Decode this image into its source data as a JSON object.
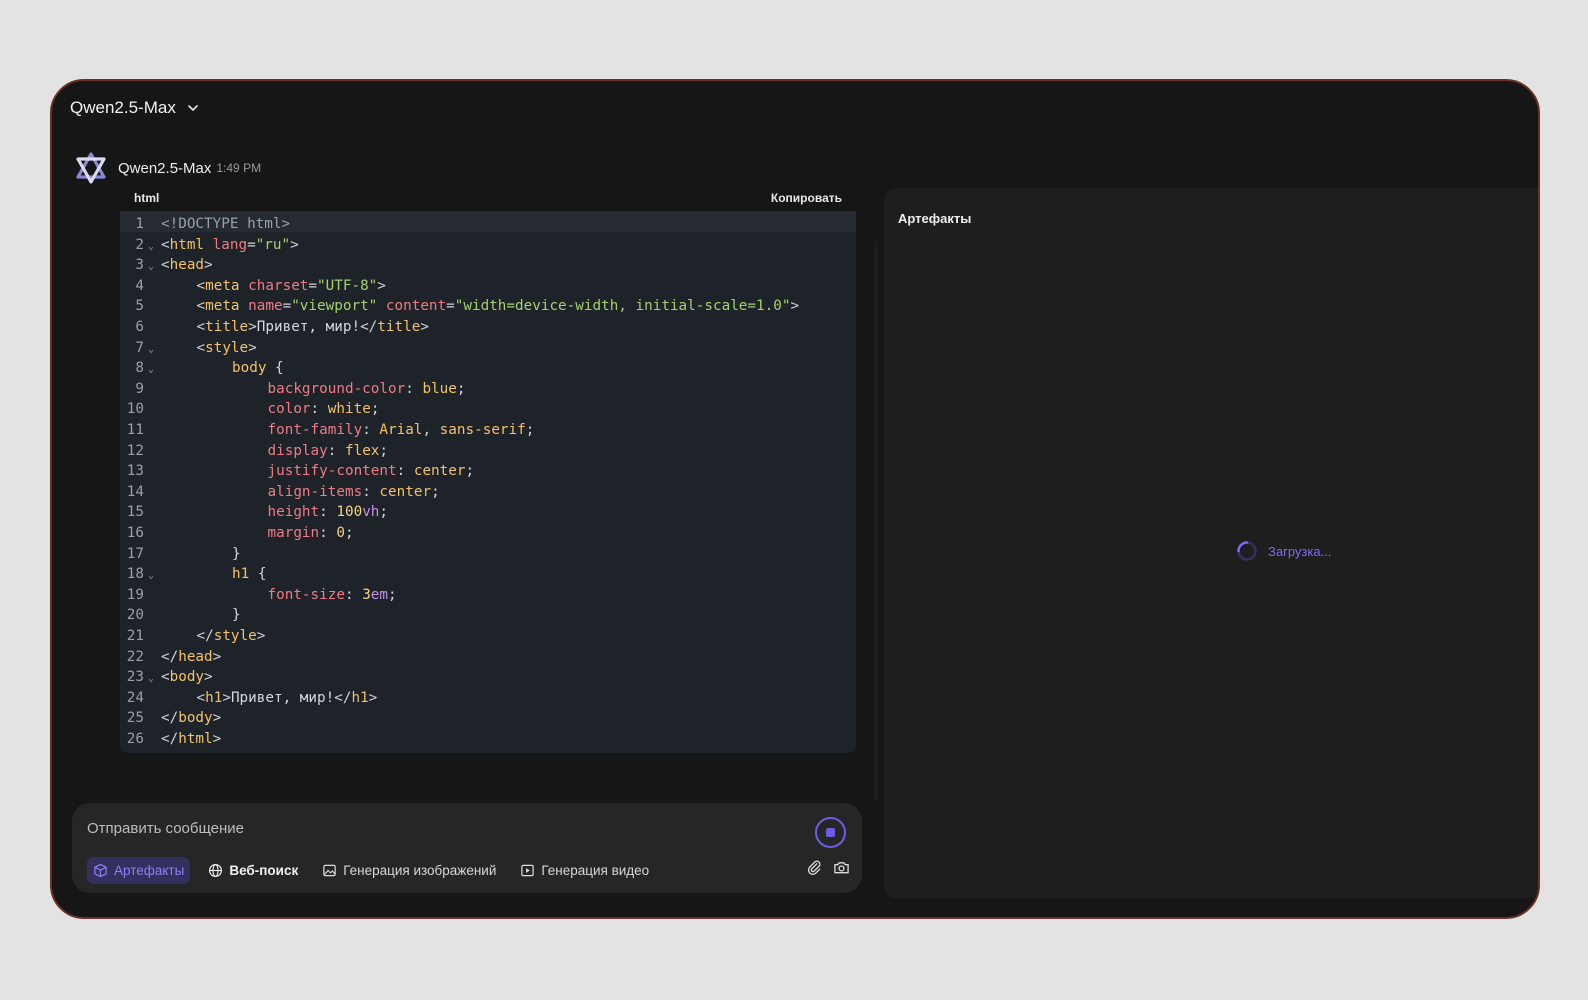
{
  "header": {
    "model_name": "Qwen2.5-Max"
  },
  "message": {
    "sender": "Qwen2.5-Max",
    "time": "1:49 PM"
  },
  "code_block": {
    "language": "html",
    "copy_label": "Копировать",
    "lines": [
      {
        "n": "1",
        "fold": false,
        "indent": 0,
        "tokens": [
          [
            "doc",
            "<!DOCTYPE html>"
          ]
        ]
      },
      {
        "n": "2",
        "fold": true,
        "indent": 0,
        "tokens": [
          [
            "punc",
            "<"
          ],
          [
            "tag",
            "html"
          ],
          [
            "txt",
            " "
          ],
          [
            "attr",
            "lang"
          ],
          [
            "punc",
            "="
          ],
          [
            "str",
            "\"ru\""
          ],
          [
            "punc",
            ">"
          ]
        ]
      },
      {
        "n": "3",
        "fold": true,
        "indent": 0,
        "tokens": [
          [
            "punc",
            "<"
          ],
          [
            "tag",
            "head"
          ],
          [
            "punc",
            ">"
          ]
        ]
      },
      {
        "n": "4",
        "fold": false,
        "indent": 1,
        "tokens": [
          [
            "punc",
            "<"
          ],
          [
            "tag",
            "meta"
          ],
          [
            "txt",
            " "
          ],
          [
            "attr",
            "charset"
          ],
          [
            "punc",
            "="
          ],
          [
            "str",
            "\"UTF-8\""
          ],
          [
            "punc",
            ">"
          ]
        ]
      },
      {
        "n": "5",
        "fold": false,
        "indent": 1,
        "tokens": [
          [
            "punc",
            "<"
          ],
          [
            "tag",
            "meta"
          ],
          [
            "txt",
            " "
          ],
          [
            "attr",
            "name"
          ],
          [
            "punc",
            "="
          ],
          [
            "str",
            "\"viewport\""
          ],
          [
            "txt",
            " "
          ],
          [
            "attr",
            "content"
          ],
          [
            "punc",
            "="
          ],
          [
            "str",
            "\"width=device-width, initial-scale=1.0\""
          ],
          [
            "punc",
            ">"
          ]
        ]
      },
      {
        "n": "6",
        "fold": false,
        "indent": 1,
        "tokens": [
          [
            "punc",
            "<"
          ],
          [
            "tag",
            "title"
          ],
          [
            "punc",
            ">"
          ],
          [
            "txt",
            "Привет, мир!"
          ],
          [
            "punc",
            "</"
          ],
          [
            "tag",
            "title"
          ],
          [
            "punc",
            ">"
          ]
        ]
      },
      {
        "n": "7",
        "fold": true,
        "indent": 1,
        "tokens": [
          [
            "punc",
            "<"
          ],
          [
            "tag",
            "style"
          ],
          [
            "punc",
            ">"
          ]
        ]
      },
      {
        "n": "8",
        "fold": true,
        "indent": 2,
        "tokens": [
          [
            "sel",
            "body"
          ],
          [
            "txt",
            " {"
          ]
        ]
      },
      {
        "n": "9",
        "fold": false,
        "indent": 3,
        "tokens": [
          [
            "prop",
            "background-color"
          ],
          [
            "txt",
            ": "
          ],
          [
            "val",
            "blue"
          ],
          [
            "txt",
            ";"
          ]
        ]
      },
      {
        "n": "10",
        "fold": false,
        "indent": 3,
        "tokens": [
          [
            "prop",
            "color"
          ],
          [
            "txt",
            ": "
          ],
          [
            "val",
            "white"
          ],
          [
            "txt",
            ";"
          ]
        ]
      },
      {
        "n": "11",
        "fold": false,
        "indent": 3,
        "tokens": [
          [
            "prop",
            "font-family"
          ],
          [
            "txt",
            ": "
          ],
          [
            "val",
            "Arial"
          ],
          [
            "txt",
            ", "
          ],
          [
            "val",
            "sans-serif"
          ],
          [
            "txt",
            ";"
          ]
        ]
      },
      {
        "n": "12",
        "fold": false,
        "indent": 3,
        "tokens": [
          [
            "prop",
            "display"
          ],
          [
            "txt",
            ": "
          ],
          [
            "val",
            "flex"
          ],
          [
            "txt",
            ";"
          ]
        ]
      },
      {
        "n": "13",
        "fold": false,
        "indent": 3,
        "tokens": [
          [
            "prop",
            "justify-content"
          ],
          [
            "txt",
            ": "
          ],
          [
            "val",
            "center"
          ],
          [
            "txt",
            ";"
          ]
        ]
      },
      {
        "n": "14",
        "fold": false,
        "indent": 3,
        "tokens": [
          [
            "prop",
            "align-items"
          ],
          [
            "txt",
            ": "
          ],
          [
            "val",
            "center"
          ],
          [
            "txt",
            ";"
          ]
        ]
      },
      {
        "n": "15",
        "fold": false,
        "indent": 3,
        "tokens": [
          [
            "prop",
            "height"
          ],
          [
            "txt",
            ": "
          ],
          [
            "num",
            "100"
          ],
          [
            "unit",
            "vh"
          ],
          [
            "txt",
            ";"
          ]
        ]
      },
      {
        "n": "16",
        "fold": false,
        "indent": 3,
        "tokens": [
          [
            "prop",
            "margin"
          ],
          [
            "txt",
            ": "
          ],
          [
            "num",
            "0"
          ],
          [
            "txt",
            ";"
          ]
        ]
      },
      {
        "n": "17",
        "fold": false,
        "indent": 2,
        "tokens": [
          [
            "txt",
            "}"
          ]
        ]
      },
      {
        "n": "18",
        "fold": true,
        "indent": 2,
        "tokens": [
          [
            "sel",
            "h1"
          ],
          [
            "txt",
            " {"
          ]
        ]
      },
      {
        "n": "19",
        "fold": false,
        "indent": 3,
        "tokens": [
          [
            "prop",
            "font-size"
          ],
          [
            "txt",
            ": "
          ],
          [
            "num",
            "3"
          ],
          [
            "unit",
            "em"
          ],
          [
            "txt",
            ";"
          ]
        ]
      },
      {
        "n": "20",
        "fold": false,
        "indent": 2,
        "tokens": [
          [
            "txt",
            "}"
          ]
        ]
      },
      {
        "n": "21",
        "fold": false,
        "indent": 1,
        "tokens": [
          [
            "punc",
            "</"
          ],
          [
            "tag",
            "style"
          ],
          [
            "punc",
            ">"
          ]
        ]
      },
      {
        "n": "22",
        "fold": false,
        "indent": 0,
        "tokens": [
          [
            "punc",
            "</"
          ],
          [
            "tag",
            "head"
          ],
          [
            "punc",
            ">"
          ]
        ]
      },
      {
        "n": "23",
        "fold": true,
        "indent": 0,
        "tokens": [
          [
            "punc",
            "<"
          ],
          [
            "tag",
            "body"
          ],
          [
            "punc",
            ">"
          ]
        ]
      },
      {
        "n": "24",
        "fold": false,
        "indent": 1,
        "tokens": [
          [
            "punc",
            "<"
          ],
          [
            "tag",
            "h1"
          ],
          [
            "punc",
            ">"
          ],
          [
            "txt",
            "Привет, мир!"
          ],
          [
            "punc",
            "</"
          ],
          [
            "tag",
            "h1"
          ],
          [
            "punc",
            ">"
          ]
        ]
      },
      {
        "n": "25",
        "fold": false,
        "indent": 0,
        "tokens": [
          [
            "punc",
            "</"
          ],
          [
            "tag",
            "body"
          ],
          [
            "punc",
            ">"
          ]
        ]
      },
      {
        "n": "26",
        "fold": false,
        "indent": 0,
        "tokens": [
          [
            "punc",
            "</"
          ],
          [
            "tag",
            "html"
          ],
          [
            "punc",
            ">"
          ]
        ]
      }
    ]
  },
  "composer": {
    "placeholder": "Отправить сообщение",
    "chips": [
      {
        "label": "Артефакты",
        "icon": "cube-icon",
        "active": true
      },
      {
        "label": "Веб-поиск",
        "icon": "globe-icon",
        "active": false
      },
      {
        "label": "Генерация изображений",
        "icon": "image-icon",
        "active": false
      },
      {
        "label": "Генерация видео",
        "icon": "video-icon",
        "active": false
      }
    ]
  },
  "artifacts": {
    "title": "Артефакты",
    "loading_text": "Загрузка..."
  },
  "colors": {
    "accent": "#6b5ce7",
    "window_border": "#6a2f26",
    "background": "#161616"
  }
}
